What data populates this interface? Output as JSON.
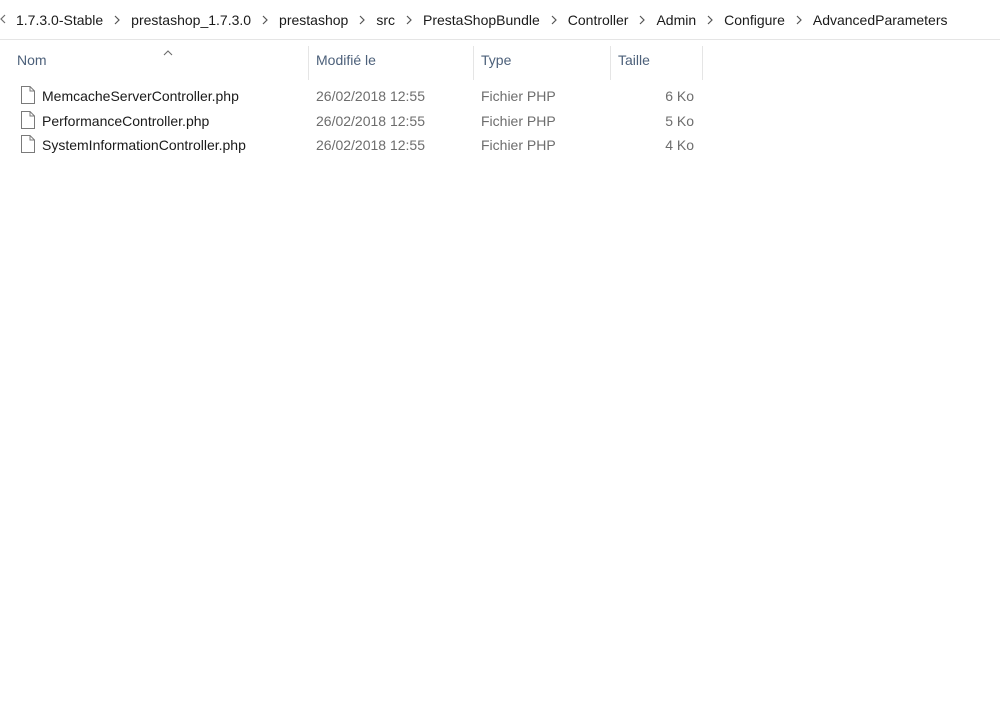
{
  "breadcrumb": {
    "items": [
      "1.7.3.0-Stable",
      "prestashop_1.7.3.0",
      "prestashop",
      "src",
      "PrestaShopBundle",
      "Controller",
      "Admin",
      "Configure",
      "AdvancedParameters"
    ]
  },
  "columns": {
    "name": "Nom",
    "modified": "Modifié le",
    "type": "Type",
    "size": "Taille"
  },
  "sort": {
    "column": "name",
    "direction": "ascending",
    "icon": "chevron-up-icon"
  },
  "files": [
    {
      "name": "MemcacheServerController.php",
      "modified": "26/02/2018 12:55",
      "type": "Fichier PHP",
      "size": "6 Ko",
      "icon": "file-icon"
    },
    {
      "name": "PerformanceController.php",
      "modified": "26/02/2018 12:55",
      "type": "Fichier PHP",
      "size": "5 Ko",
      "icon": "file-icon"
    },
    {
      "name": "SystemInformationController.php",
      "modified": "26/02/2018 12:55",
      "type": "Fichier PHP",
      "size": "4 Ko",
      "icon": "file-icon"
    }
  ],
  "colors": {
    "header_text": "#4c607a",
    "secondary_text": "#6d6d6d",
    "primary_text": "#1a1a1a",
    "divider": "#e5e5e5"
  }
}
